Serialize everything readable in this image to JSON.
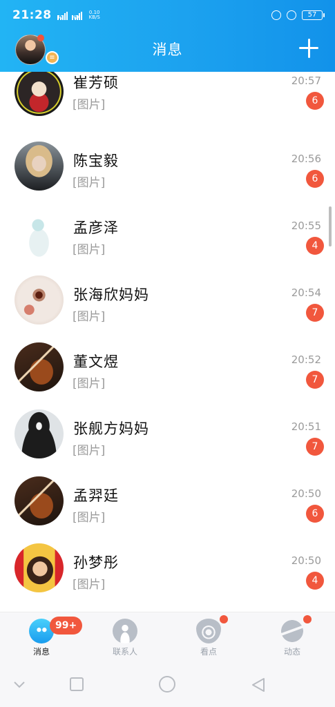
{
  "status_bar": {
    "time": "21:28",
    "signal1_label": "4G",
    "signal2_label": "HD",
    "net_speed_value": "0.10",
    "net_speed_unit": "KB/S",
    "battery": "57"
  },
  "header": {
    "title": "消息"
  },
  "chats": [
    {
      "name": "崔芳硕",
      "preview": "[图片]",
      "time": "20:57",
      "unread": "6"
    },
    {
      "name": "陈宝毅",
      "preview": "[图片]",
      "time": "20:56",
      "unread": "6"
    },
    {
      "name": "孟彦泽",
      "preview": "[图片]",
      "time": "20:55",
      "unread": "4"
    },
    {
      "name": "张海欣妈妈",
      "preview": "[图片]",
      "time": "20:54",
      "unread": "7"
    },
    {
      "name": "董文煜",
      "preview": "[图片]",
      "time": "20:52",
      "unread": "7"
    },
    {
      "name": "张舰方妈妈",
      "preview": "[图片]",
      "time": "20:51",
      "unread": "7"
    },
    {
      "name": "孟羿廷",
      "preview": "[图片]",
      "time": "20:50",
      "unread": "6"
    },
    {
      "name": "孙梦彤",
      "preview": "[图片]",
      "time": "20:50",
      "unread": "4"
    }
  ],
  "tabs": [
    {
      "label": "消息",
      "badge": "99+"
    },
    {
      "label": "联系人"
    },
    {
      "label": "看点"
    },
    {
      "label": "动态"
    }
  ],
  "icons": {
    "add": "plus-icon",
    "messages": "chat-bubble-icon",
    "contacts": "person-icon",
    "discover": "eye-icon",
    "moments": "planet-icon"
  },
  "colors": {
    "header_start": "#22b4f4",
    "header_end": "#1292ea",
    "badge": "#f1573d"
  }
}
